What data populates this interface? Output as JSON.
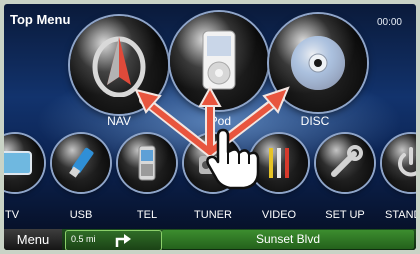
{
  "header": {
    "title": "Top Menu",
    "clock": "00:00"
  },
  "main_sources": [
    {
      "id": "nav",
      "label": "NAV",
      "icon": "compass-icon"
    },
    {
      "id": "ipod",
      "label": "iPod",
      "icon": "ipod-icon"
    },
    {
      "id": "disc",
      "label": "DISC",
      "icon": "disc-icon"
    }
  ],
  "sources": [
    {
      "id": "tv",
      "label": "TV",
      "icon": "tv-icon"
    },
    {
      "id": "usb",
      "label": "USB",
      "icon": "usb-icon"
    },
    {
      "id": "tel",
      "label": "TEL",
      "icon": "phone-icon"
    },
    {
      "id": "tuner",
      "label": "TUNER",
      "icon": "tuner-icon"
    },
    {
      "id": "video",
      "label": "VIDEO",
      "icon": "av-cable-icon"
    },
    {
      "id": "setup",
      "label": "SET UP",
      "icon": "wrench-icon"
    },
    {
      "id": "standby",
      "label": "STANDBY",
      "icon": "power-icon"
    }
  ],
  "bottom_bar": {
    "menu_label": "Menu",
    "distance": "0.5 mi",
    "turn_icon": "turn-right-icon",
    "street": "Sunset Blvd"
  },
  "overlay": {
    "gesture_icon": "hand-pointer-icon",
    "arrow_color": "#e8553e"
  }
}
